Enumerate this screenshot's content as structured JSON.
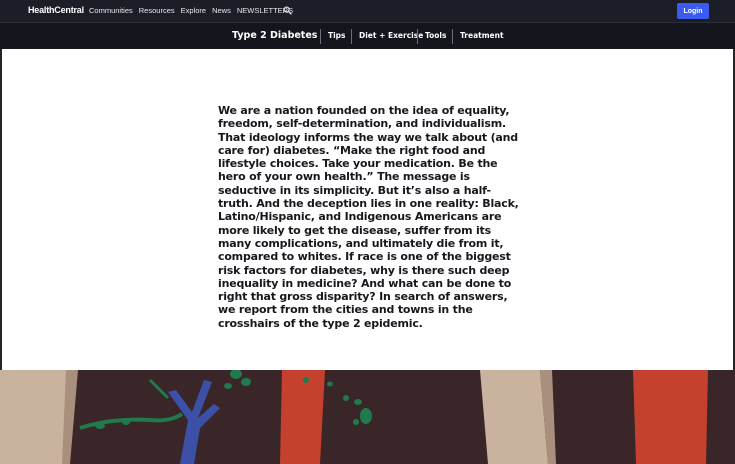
{
  "topbar": {
    "logo": "HealthCentral",
    "links": [
      "Communities",
      "Resources",
      "Explore",
      "News",
      "NEWSLETTERS"
    ],
    "search_icon": "search-icon",
    "login_label": "Login",
    "login_color": "#3b5bf0",
    "background": "#1b1e27"
  },
  "subnav": {
    "title": "Type 2 Diabetes",
    "items": [
      "Tips",
      "Diet + Exercise",
      "Tools",
      "Treatment"
    ]
  },
  "article": {
    "intro": "We are a nation founded on the idea of equality, freedom, self-determination, and individualism. That ideology informs the way we talk about (and care for) diabetes. “Make the right food and lifestyle choices. Take your medication. Be the hero of your own health.” The message is seductive in its simplicity. But it’s also a half-truth. And the deception lies in one reality: Black, Latino/Hispanic, and Indigenous Americans are more likely to get the disease, suffer from its many complications, and ultimately die from it, compared to whites. If race is one of the biggest risk factors for diabetes, why is there such deep inequality in medicine? And what can be done to right that gross disparity? In search of answers, we report from the cities and towns in the crosshairs of the type 2 epidemic."
  },
  "illustration": {
    "colors": {
      "background": "#3a2628",
      "beige": "#c9b29e",
      "red": "#c4412e",
      "blue": "#3c50a8",
      "green": "#1f7a4c"
    }
  }
}
